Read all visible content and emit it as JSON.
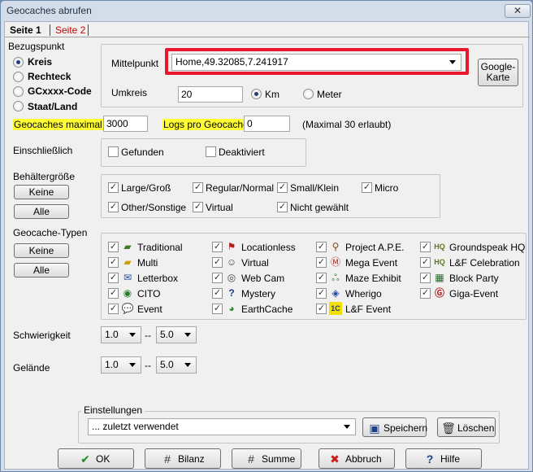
{
  "window": {
    "title": "Geocaches abrufen",
    "close": "✕"
  },
  "tabs": [
    {
      "label": "Seite 1",
      "active": true
    },
    {
      "label": "Seite 2",
      "active": false
    }
  ],
  "reference": {
    "label": "Bezugspunkt",
    "options": [
      {
        "label": "Kreis",
        "selected": true
      },
      {
        "label": "Rechteck",
        "selected": false
      },
      {
        "label": "GCxxxx-Code",
        "selected": false
      },
      {
        "label": "Staat/Land",
        "selected": false
      }
    ],
    "center_label": "Mittelpunkt",
    "center_value": "Home,49.32085,7.241917",
    "google_button": "Google-Karte",
    "radius_label": "Umkreis",
    "radius_value": "20",
    "unit_km": "Km",
    "unit_meter": "Meter",
    "unit_selected": "Km"
  },
  "limits": {
    "max_label": "Geocaches maximal",
    "max_value": "3000",
    "logs_label": "Logs pro Geocache",
    "logs_value": "0",
    "note": "(Maximal 30 erlaubt)"
  },
  "include": {
    "label": "Einschließlich",
    "items": [
      {
        "label": "Gefunden",
        "checked": false
      },
      {
        "label": "Deaktiviert",
        "checked": false
      }
    ]
  },
  "container": {
    "label": "Behältergröße",
    "none_button": "Keine",
    "all_button": "Alle",
    "items": [
      {
        "label": "Large/Groß",
        "checked": true
      },
      {
        "label": "Regular/Normal",
        "checked": true
      },
      {
        "label": "Small/Klein",
        "checked": true
      },
      {
        "label": "Micro",
        "checked": true
      },
      {
        "label": "Other/Sonstige",
        "checked": true
      },
      {
        "label": "Virtual",
        "checked": true
      },
      {
        "label": "Nicht gewählt",
        "checked": true
      }
    ]
  },
  "types": {
    "label": "Geocache-Typen",
    "none_button": "Keine",
    "all_button": "Alle",
    "items": [
      {
        "label": "Traditional",
        "checked": true,
        "icon": "traditional-icon"
      },
      {
        "label": "Locationless",
        "checked": true,
        "icon": "locationless-icon"
      },
      {
        "label": "Project A.P.E.",
        "checked": true,
        "icon": "project-ape-icon"
      },
      {
        "label": "Groundspeak HQ",
        "checked": true,
        "icon": "groundspeak-hq-icon"
      },
      {
        "label": "Multi",
        "checked": true,
        "icon": "multi-icon"
      },
      {
        "label": "Virtual",
        "checked": true,
        "icon": "virtual-icon"
      },
      {
        "label": "Mega Event",
        "checked": true,
        "icon": "mega-event-icon"
      },
      {
        "label": "L&F Celebration",
        "checked": true,
        "icon": "lf-celebration-icon"
      },
      {
        "label": "Letterbox",
        "checked": true,
        "icon": "letterbox-icon"
      },
      {
        "label": "Web Cam",
        "checked": true,
        "icon": "webcam-icon"
      },
      {
        "label": "Maze Exhibit",
        "checked": true,
        "icon": "maze-exhibit-icon"
      },
      {
        "label": "Block Party",
        "checked": true,
        "icon": "block-party-icon"
      },
      {
        "label": "CITO",
        "checked": true,
        "icon": "cito-icon"
      },
      {
        "label": "Mystery",
        "checked": true,
        "icon": "mystery-icon"
      },
      {
        "label": "Wherigo",
        "checked": true,
        "icon": "wherigo-icon"
      },
      {
        "label": "Giga-Event",
        "checked": true,
        "icon": "giga-event-icon"
      },
      {
        "label": "Event",
        "checked": true,
        "icon": "event-icon"
      },
      {
        "label": "EarthCache",
        "checked": true,
        "icon": "earthcache-icon"
      },
      {
        "label": "L&F Event",
        "checked": true,
        "icon": "lf-event-icon"
      }
    ]
  },
  "difficulty": {
    "label": "Schwierigkeit",
    "from": "1.0",
    "to": "5.0",
    "sep": "--"
  },
  "terrain": {
    "label": "Gelände",
    "from": "1.0",
    "to": "5.0",
    "sep": "--"
  },
  "settings": {
    "label": "Einstellungen",
    "selected": "... zuletzt verwendet",
    "save_button": "Speichern",
    "delete_button": "Löschen"
  },
  "footer": {
    "ok": "OK",
    "bilanz": "Bilanz",
    "summe": "Summe",
    "abbruch": "Abbruch",
    "hilfe": "Hilfe"
  },
  "colors": {
    "highlight": "#ffff33",
    "annotation_box": "#e8192c",
    "inactive_tab": "#cc0000"
  }
}
